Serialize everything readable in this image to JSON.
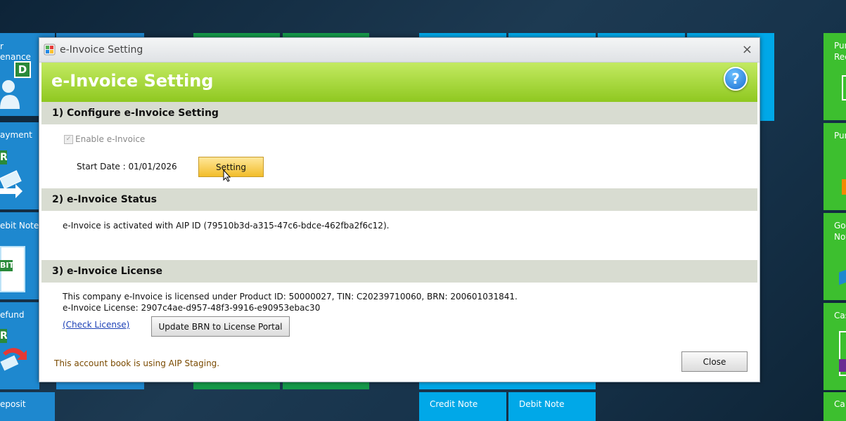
{
  "dialog": {
    "window_title": "e-Invoice Setting",
    "header_title": "e-Invoice Setting",
    "help_glyph": "?",
    "close_glyph": "×",
    "section1": {
      "title": "1) Configure e-Invoice Setting",
      "enable_label": "Enable e-Invoice",
      "enable_checked": true,
      "start_date_label": "Start Date : 01/01/2026",
      "setting_button": "Setting"
    },
    "section2": {
      "title": "2) e-Invoice Status",
      "status_text": "e-Invoice is activated with AIP ID (79510b3d-a315-47c6-bdce-462fba2f6c12)."
    },
    "section3": {
      "title": "3) e-Invoice License",
      "license_text": "This company e-Invoice is licensed under Product ID: 50000027, TIN: C20239710060, BRN: 200601031841.",
      "license_key": "e-Invoice License: 2907c4ae-d957-48f3-9916-e90953ebac30",
      "check_license_link": "(Check License)",
      "update_brn_button": "Update BRN to License Portal"
    },
    "footer_note": "This account book is using AIP Staging.",
    "close_button": "Close"
  },
  "background_tiles": {
    "left_labels": [
      "r",
      "enance",
      "ayment",
      "ebit Note",
      "efund",
      "eposit"
    ],
    "left_badges": [
      "D",
      "R",
      "BIT",
      "R"
    ],
    "bottom_labels": [
      "Credit Note",
      "Debit Note"
    ],
    "right_labels": [
      "Pur",
      "Rec",
      "Pur",
      "Goo",
      "Not",
      "Cas",
      "Ca"
    ]
  },
  "colors": {
    "tile_blue": "#1e88cf",
    "tile_cyan": "#00a8e8",
    "tile_green": "#159a4a",
    "tile_lime": "#3dbf2f",
    "header_green": "#9ad228",
    "footer_note": "#7a4a00"
  }
}
